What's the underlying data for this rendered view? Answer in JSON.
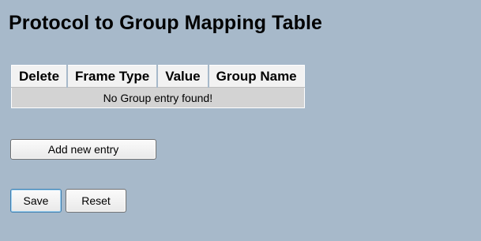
{
  "page": {
    "title": "Protocol to Group Mapping Table"
  },
  "table": {
    "columns": [
      "Delete",
      "Frame Type",
      "Value",
      "Group Name"
    ],
    "empty_message": "No Group entry found!"
  },
  "buttons": {
    "add_new_entry": "Add new entry",
    "save": "Save",
    "reset": "Reset"
  }
}
